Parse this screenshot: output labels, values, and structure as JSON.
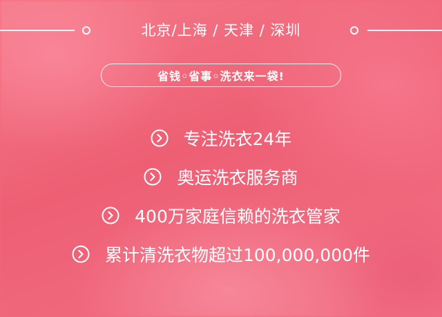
{
  "header": {
    "cities": "北京/上海 / 天津 / 深圳"
  },
  "slogan": "省钱◦省事◦洗衣来一袋!",
  "features": [
    {
      "icon": "chevron-right-circle-icon",
      "text": "专注洗衣24年"
    },
    {
      "icon": "chevron-right-circle-icon",
      "text": "奥运洗衣服务商"
    },
    {
      "icon": "chevron-right-circle-icon",
      "text": "400万家庭信赖的洗衣管家"
    },
    {
      "icon": "chevron-right-circle-icon",
      "text": "累计清洗衣物超过100,000,000件"
    }
  ],
  "colors": {
    "background": "#f0697a",
    "text": "#ffffff"
  }
}
